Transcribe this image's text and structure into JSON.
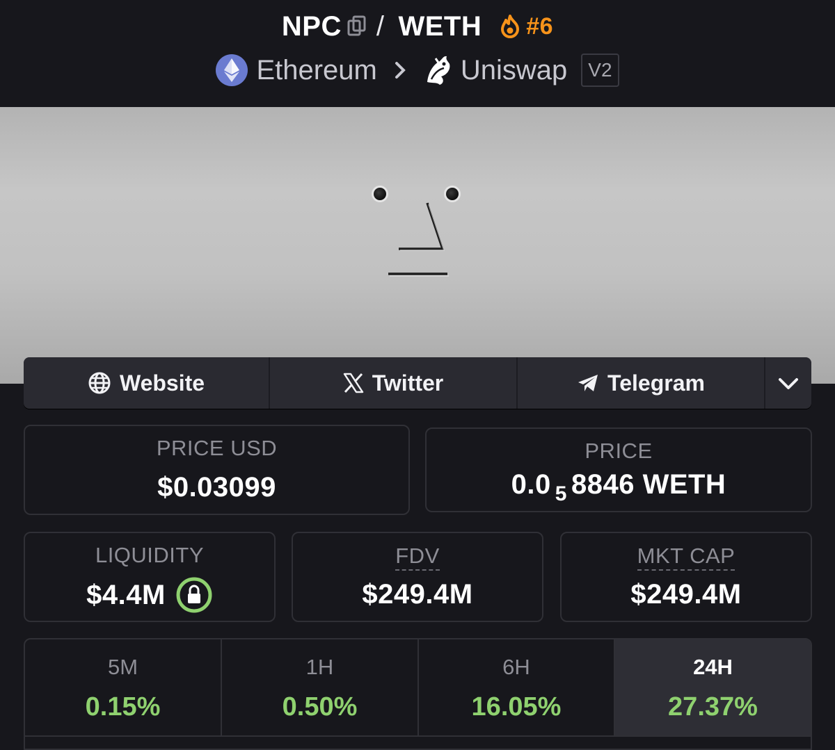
{
  "header": {
    "base_token": "NPC",
    "separator": "/",
    "quote_token": "WETH",
    "rank": "#6",
    "chain": "Ethereum",
    "dex": "Uniswap",
    "dex_version": "V2"
  },
  "social": {
    "website_label": "Website",
    "twitter_label": "Twitter",
    "telegram_label": "Telegram"
  },
  "stats": {
    "price_usd_label": "PRICE USD",
    "price_usd_value": "$0.03099",
    "price_label": "PRICE",
    "price_prefix": "0.0",
    "price_zeros": "5",
    "price_digits": "8846 WETH",
    "liquidity_label": "LIQUIDITY",
    "liquidity_value": "$4.4M",
    "fdv_label": "FDV",
    "fdv_value": "$249.4M",
    "mktcap_label": "MKT CAP",
    "mktcap_value": "$249.4M"
  },
  "timeframes": [
    {
      "label": "5M",
      "value": "0.15%"
    },
    {
      "label": "1H",
      "value": "0.50%"
    },
    {
      "label": "6H",
      "value": "16.05%"
    },
    {
      "label": "24H",
      "value": "27.37%"
    }
  ],
  "colors": {
    "background": "#17171c",
    "accent_orange": "#f7931a",
    "positive_green": "#8fd16f",
    "lock_green": "#8fd16f"
  },
  "icons": {
    "copy": "copy-icon",
    "flame": "flame-icon",
    "chain": "ethereum-icon",
    "dex": "uniswap-icon",
    "website": "globe-icon",
    "twitter": "x-icon",
    "telegram": "telegram-icon",
    "more": "chevron-down-icon",
    "lock": "lock-icon"
  }
}
